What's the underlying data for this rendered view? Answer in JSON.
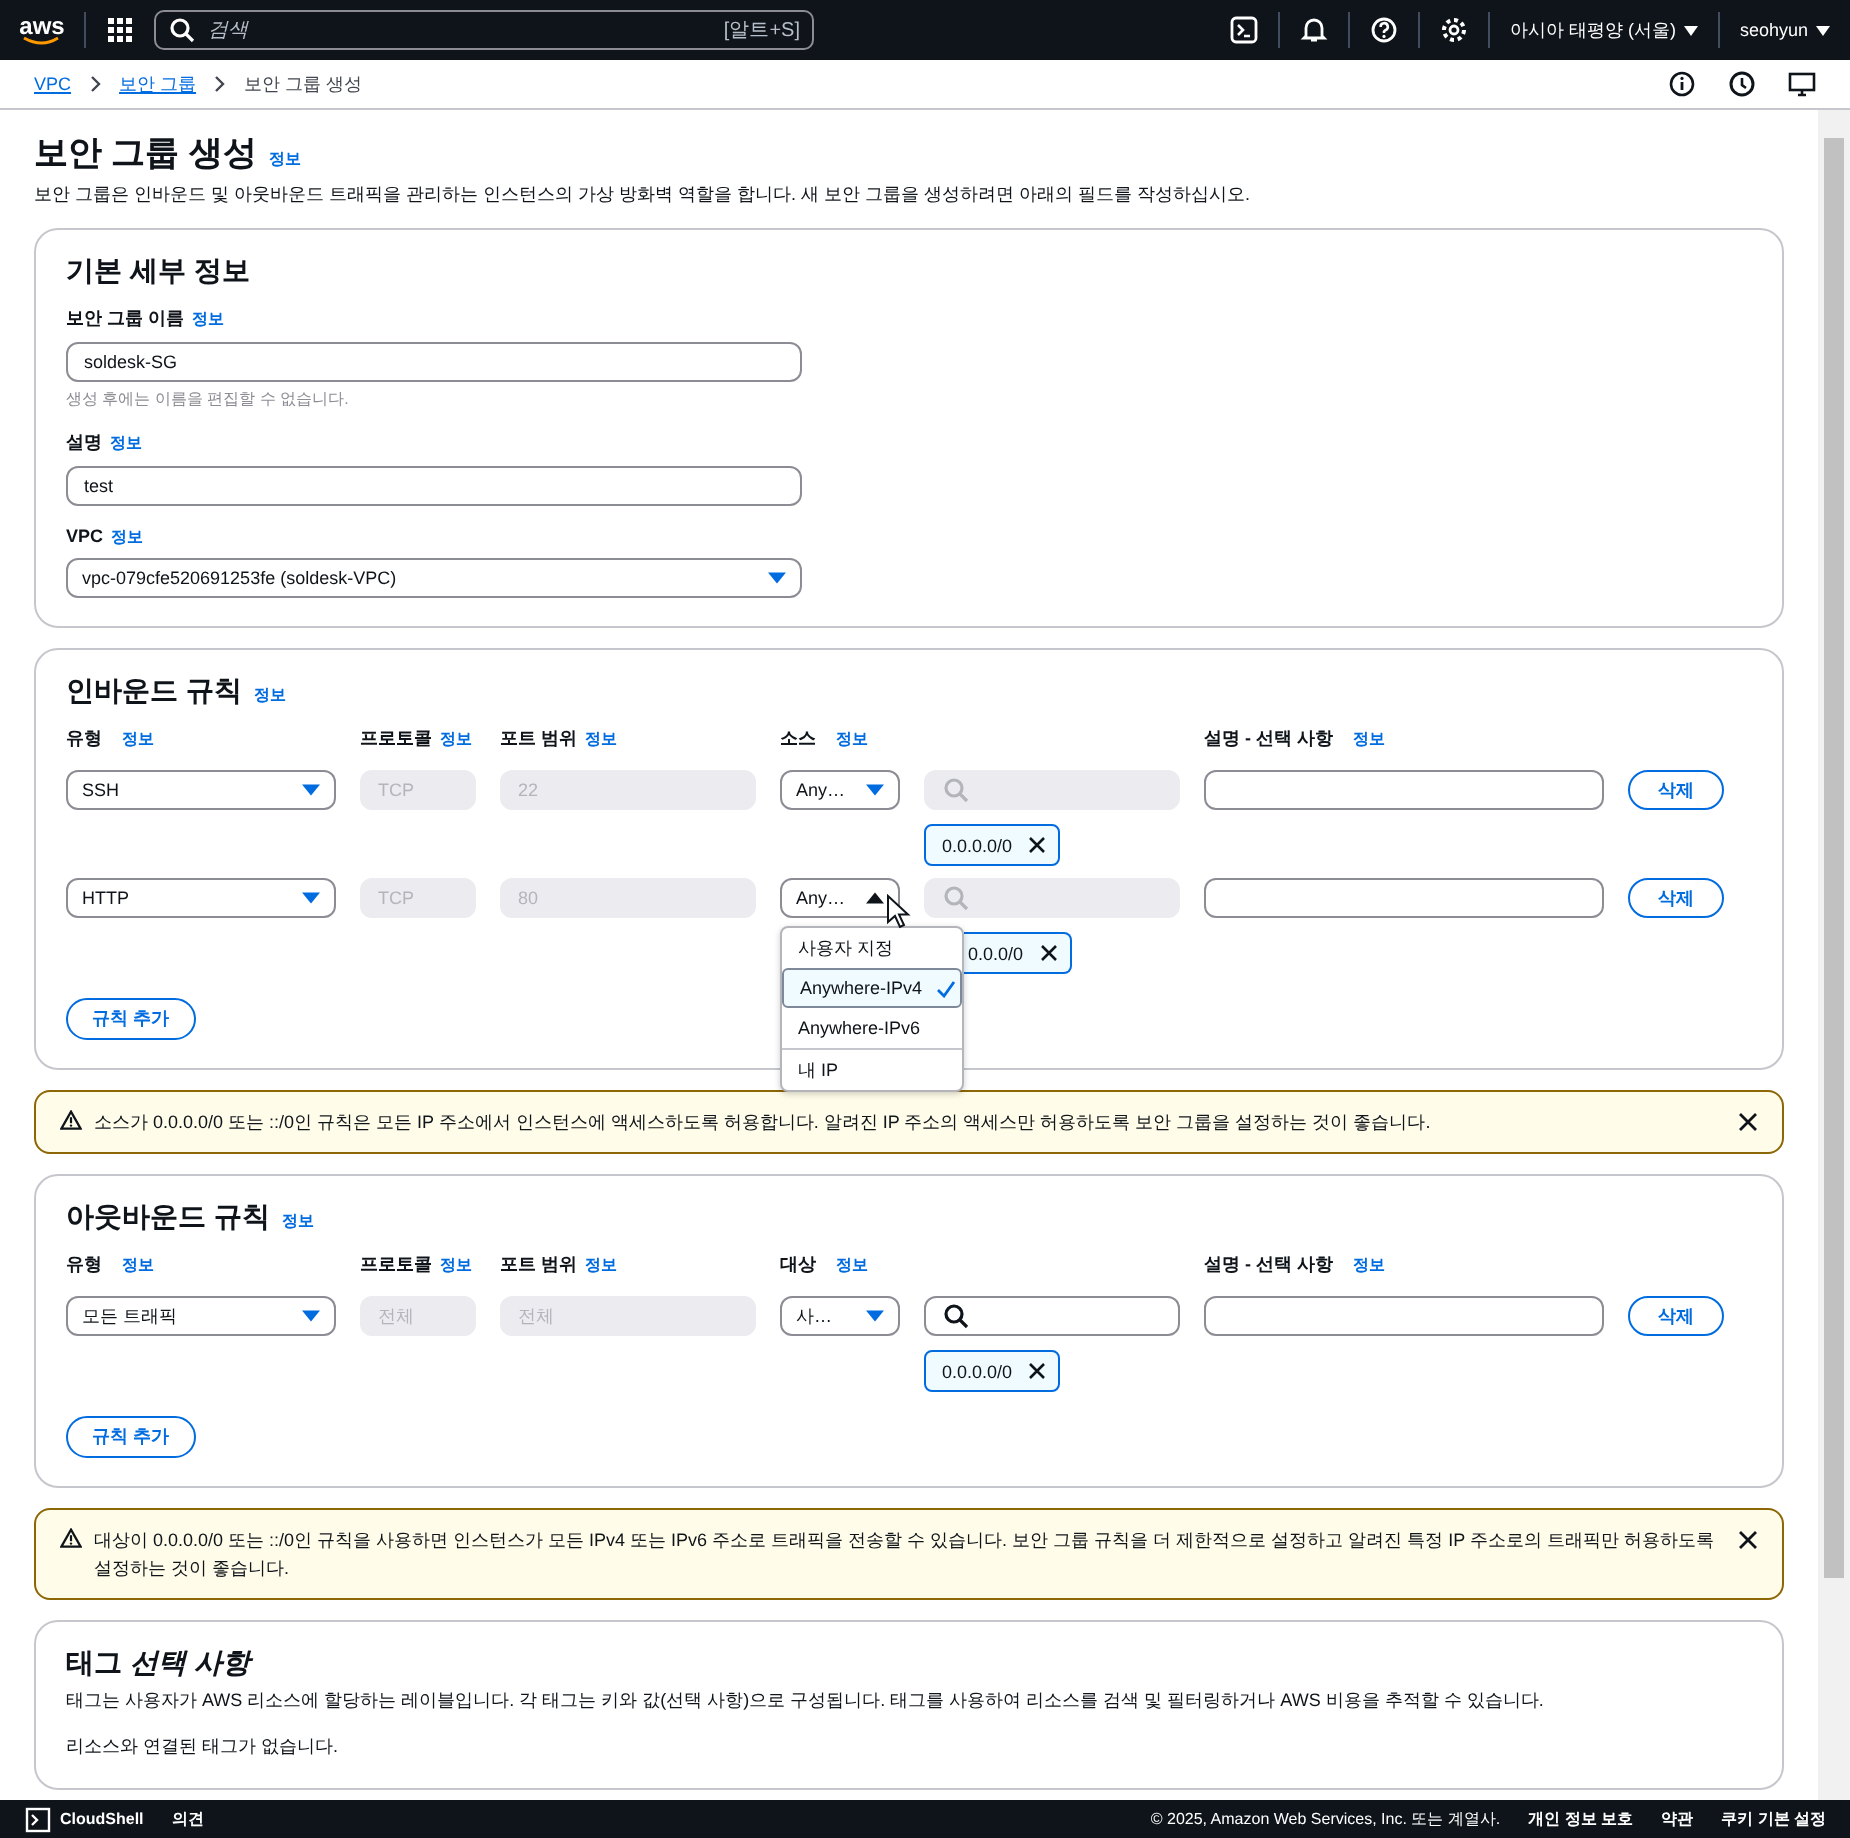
{
  "topbar": {
    "logo": "aws",
    "search_placeholder": "검색",
    "shortcut": "[알트+S]",
    "region": "아시아 태평양 (서울)",
    "user": "seohyun"
  },
  "breadcrumbs": [
    {
      "label": "VPC",
      "link": true
    },
    {
      "label": "보안 그룹",
      "link": true
    },
    {
      "label": "보안 그룹 생성",
      "link": false
    }
  ],
  "page": {
    "title": "보안 그룹 생성",
    "info": "정보",
    "description": "보안 그룹은 인바운드 및 아웃바운드 트래픽을 관리하는 인스턴스의 가상 방화벽 역할을 합니다. 새 보안 그룹을 생성하려면 아래의 필드를 작성하십시오."
  },
  "basic_details": {
    "title": "기본 세부 정보",
    "fields": [
      {
        "kind": "text",
        "label": "보안 그룹 이름",
        "info": "정보",
        "value": "soldesk-SG",
        "hint": "생성 후에는 이름을 편집할 수 없습니다."
      },
      {
        "kind": "text",
        "label": "설명",
        "info": "정보",
        "value": "test"
      },
      {
        "kind": "select",
        "label": "VPC",
        "info": "정보",
        "value": "vpc-079cfe520691253fe (soldesk-VPC)"
      }
    ]
  },
  "inbound_rules": {
    "title": "인바운드 규칙",
    "info": "정보",
    "columns": [
      {
        "label": "유형",
        "info": "정보"
      },
      {
        "label": "프로토콜",
        "info": "정보"
      },
      {
        "label": "포트 범위",
        "info": "정보"
      },
      {
        "label": "소스",
        "info": "정보"
      },
      {
        "label": "설명 - 선택 사항",
        "info": "정보"
      }
    ],
    "rules": [
      {
        "type": "SSH",
        "protocol": "TCP",
        "port_range": "22",
        "source": "Any…",
        "source_open": false,
        "tokens": [
          "0.0.0.0/0"
        ],
        "delete": "삭제"
      },
      {
        "type": "HTTP",
        "protocol": "TCP",
        "port_range": "80",
        "source": "Any…",
        "source_open": true,
        "tokens": [
          "0.0.0/0"
        ],
        "delete": "삭제",
        "menu": [
          [
            {
              "label": "사용자 지정",
              "selected": false
            },
            {
              "label": "Anywhere-IPv4",
              "selected": true
            },
            {
              "label": "Anywhere-IPv6",
              "selected": false
            }
          ],
          [
            {
              "label": "내 IP",
              "selected": false
            }
          ]
        ]
      }
    ],
    "add_button": "규칙 추가"
  },
  "inbound_warning": {
    "text": "소스가 0.0.0.0/0 또는 ::/0인 규칙은 모든 IP 주소에서 인스턴스에 액세스하도록 허용합니다. 알려진 IP 주소의 액세스만 허용하도록 보안 그룹을 설정하는 것이 좋습니다."
  },
  "outbound_rules": {
    "title": "아웃바운드 규칙",
    "info": "정보",
    "columns": [
      {
        "label": "유형",
        "info": "정보"
      },
      {
        "label": "프로토콜",
        "info": "정보"
      },
      {
        "label": "포트 범위",
        "info": "정보"
      },
      {
        "label": "대상",
        "info": "정보"
      },
      {
        "label": "설명 - 선택 사항",
        "info": "정보"
      }
    ],
    "rules": [
      {
        "type": "모든 트래픽",
        "protocol": "전체",
        "port_range": "전체",
        "source": "사…",
        "source_open": false,
        "tokens": [
          "0.0.0.0/0"
        ],
        "delete": "삭제"
      }
    ],
    "add_button": "규칙 추가"
  },
  "outbound_warning": {
    "text": "대상이 0.0.0.0/0 또는 ::/0인 규칙을 사용하면 인스턴스가 모든 IPv4 또는 IPv6 주소로 트래픽을 전송할 수 있습니다. 보안 그룹 규칙을 더 제한적으로 설정하고 알려진 특정 IP 주소로의 트래픽만 허용하도록 설정하는 것이 좋습니다."
  },
  "tags": {
    "title": "태그 *선택 사항*",
    "description": "태그는 사용자가 AWS 리소스에 할당하는 레이블입니다. 각 태그는 키와 값(선택 사항)으로 구성됩니다. 태그를 사용하여 리소스를 검색 및 필터링하거나 AWS 비용을 추적할 수 있습니다.",
    "empty": "리소스와 연결된 태그가 없습니다."
  },
  "footer": {
    "cloudshell": "CloudShell",
    "feedback": "의견",
    "copyright": "© 2025, Amazon Web Services, Inc. 또는 계열사.",
    "links": [
      "개인 정보 보호",
      "약관",
      "쿠키 기본 설정"
    ]
  }
}
